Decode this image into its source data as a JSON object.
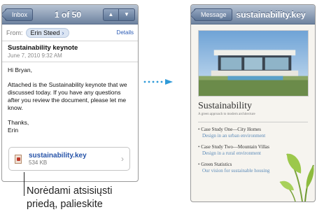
{
  "email": {
    "nav": {
      "back_label": "Inbox",
      "counter": "1 of 50",
      "up_arrow": "▲",
      "down_arrow": "▼"
    },
    "from_label": "From:",
    "sender": "Erin Steed",
    "details_label": "Details",
    "subject": "Sustainability keynote",
    "date": "June 7, 2010 9:32 AM",
    "body": {
      "greeting": "Hi Bryan,",
      "paragraph": "Attached is the Sustainability keynote that we discussed today. If you have any questions after you review the document, please let me know.",
      "closing": "Thanks,",
      "signature": "Erin"
    },
    "attachment": {
      "name": "sustainability.key",
      "size": "534 KB"
    }
  },
  "callout": {
    "line1": "Norėdami atsisiųsti",
    "line2": "priedą, palieskite"
  },
  "document": {
    "nav": {
      "back_label": "Message",
      "title": "sustainability.key"
    },
    "heading": "Sustainability",
    "subheading": "A green approach to modern architecture",
    "cases": [
      {
        "title": "Case Study One—City Homes",
        "desc": "Design in an urban environment"
      },
      {
        "title": "Case Study Two—Mountain Villas",
        "desc": "Design in a rural environment"
      },
      {
        "title": "Green Statistics",
        "desc": "Our vision for sustainable housing"
      }
    ]
  }
}
